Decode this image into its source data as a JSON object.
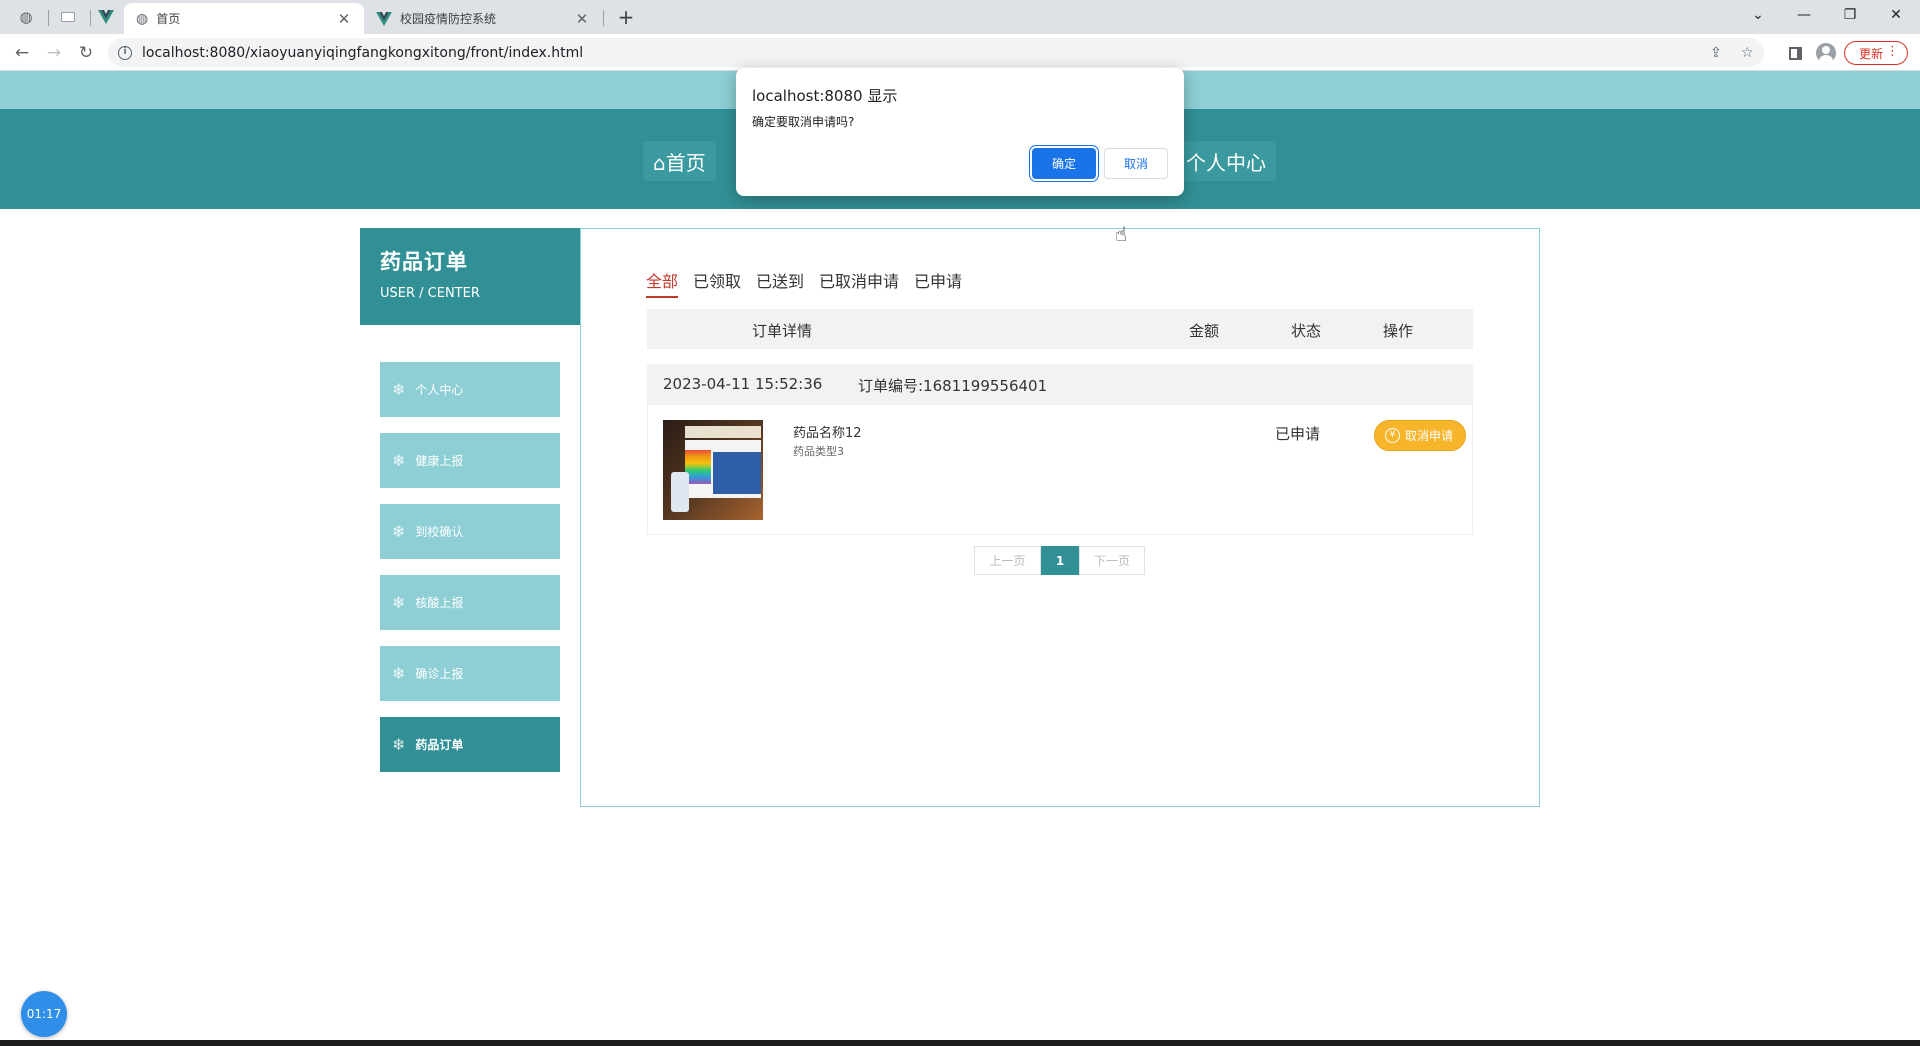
{
  "browser": {
    "tabs": [
      {
        "title": "首页",
        "active": true
      },
      {
        "title": "校园疫情防控系统",
        "active": false
      }
    ],
    "url": "localhost:8080/xiaoyuanyiqingfangkongxitong/front/index.html",
    "update_label": "更新"
  },
  "nav": {
    "items": [
      "⌂首页",
      "个人中心"
    ]
  },
  "sidebar": {
    "title": "药品订单",
    "subtitle": "USER / CENTER",
    "items": [
      "个人中心",
      "健康上报",
      "到校确认",
      "核酸上报",
      "确诊上报",
      "药品订单"
    ],
    "active_index": 5
  },
  "filters": {
    "tabs": [
      "全部",
      "已领取",
      "已送到",
      "已取消申请",
      "已申请"
    ],
    "active_index": 0
  },
  "table": {
    "headers": {
      "detail": "订单详情",
      "amount": "金额",
      "status": "状态",
      "action": "操作"
    }
  },
  "order": {
    "datetime": "2023-04-11 15:52:36",
    "order_no": "订单编号:1681199556401",
    "product_name": "药品名称12",
    "product_type": "药品类型3",
    "status": "已申请",
    "action_label": "取消申请"
  },
  "pagination": {
    "prev": "上一页",
    "current": "1",
    "next": "下一页"
  },
  "dialog": {
    "title": "localhost:8080 显示",
    "message": "确定要取消申请吗?",
    "ok": "确定",
    "cancel": "取消"
  },
  "timer": "01:17",
  "colors": {
    "primary": "#319095",
    "light": "#8ecfd5",
    "accent": "#f7b52c",
    "active_tab": "#c0392b"
  }
}
